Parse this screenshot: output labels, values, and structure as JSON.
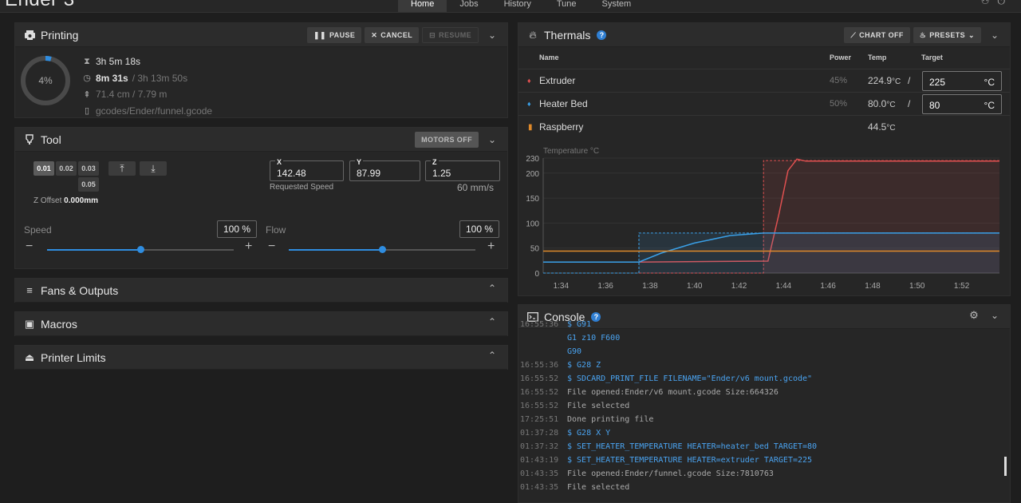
{
  "app": {
    "title": "Ender 3"
  },
  "nav": {
    "tabs": [
      "Home",
      "Jobs",
      "History",
      "Tune",
      "System"
    ]
  },
  "printing": {
    "title": "Printing",
    "buttons": {
      "pause": "PAUSE",
      "cancel": "CANCEL",
      "resume": "RESUME"
    },
    "progress_label": "4%",
    "progress_value": 4,
    "total_time": "3h 5m 18s",
    "elapsed": "8m 31s",
    "remaining": "/ 3h 13m 50s",
    "filament": "71.4 cm / 7.79 m",
    "file": "gcodes/Ender/funnel.gcode"
  },
  "tool": {
    "title": "Tool",
    "motors_off": "MOTORS OFF",
    "z_steps": [
      "0.01",
      "0.02",
      "0.03",
      "0.05"
    ],
    "z_offset_label": "Z Offset",
    "z_offset_value": "0.000mm",
    "x_label": "X",
    "x_value": "142.48",
    "y_label": "Y",
    "y_value": "87.99",
    "z_label": "Z",
    "z_value": "1.25",
    "requested_speed_label": "Requested Speed",
    "requested_speed": "60 mm/s",
    "speed_label": "Speed",
    "speed_value": "100 %",
    "flow_label": "Flow",
    "flow_value": "100 %"
  },
  "fans": {
    "title": "Fans & Outputs"
  },
  "macros": {
    "title": "Macros"
  },
  "limits": {
    "title": "Printer Limits"
  },
  "thermals": {
    "title": "Thermals",
    "chart_off": "CHART OFF",
    "presets": "PRESETS",
    "headers": {
      "name": "Name",
      "power": "Power",
      "temp": "Temp",
      "target": "Target"
    },
    "rows": [
      {
        "name": "Extruder",
        "power": "45%",
        "temp": "224.9",
        "unit": "°C",
        "slash": "/",
        "target": "225",
        "target_unit": "°C",
        "color": "#e05050"
      },
      {
        "name": "Heater Bed",
        "power": "50%",
        "temp": "80.0",
        "unit": "°C",
        "slash": "/",
        "target": "80",
        "target_unit": "°C",
        "color": "#3aa0e8"
      },
      {
        "name": "Raspberry",
        "power": "",
        "temp": "44.5",
        "unit": "°C",
        "slash": "",
        "target": "",
        "target_unit": "",
        "color": "#e08a2a"
      }
    ]
  },
  "chart_data": {
    "type": "line",
    "title": "Temperature °C",
    "xlabel": "",
    "ylabel": "Temperature °C",
    "x_ticks": [
      "1:34",
      "1:36",
      "1:38",
      "1:40",
      "1:42",
      "1:44",
      "1:46",
      "1:48",
      "1:50",
      "1:52"
    ],
    "y_ticks": [
      0,
      50,
      100,
      150,
      200,
      230
    ],
    "ylim": [
      0,
      230
    ],
    "series": [
      {
        "name": "Extruder",
        "color": "#e05050",
        "x": [
          "1:33.2",
          "1:37.5",
          "1:43.3",
          "1:43.8",
          "1:44.2",
          "1:44.6",
          "1:45",
          "1:53.7"
        ],
        "y": [
          22,
          22,
          24,
          120,
          205,
          228,
          224,
          224
        ]
      },
      {
        "name": "Extruder Target",
        "color": "#e05050",
        "dashed": true,
        "x": [
          "1:33.2",
          "1:43.1",
          "1:43.1",
          "1:53.7"
        ],
        "y": [
          0,
          0,
          225,
          225
        ]
      },
      {
        "name": "Heater Bed",
        "color": "#3aa0e8",
        "x": [
          "1:33.2",
          "1:37.5",
          "1:38.5",
          "1:40",
          "1:41.6",
          "1:43.1",
          "1:53.7"
        ],
        "y": [
          22,
          22,
          40,
          60,
          75,
          80,
          80
        ]
      },
      {
        "name": "Heater Bed Target",
        "color": "#3aa0e8",
        "dashed": true,
        "x": [
          "1:33.2",
          "1:37.5",
          "1:37.5",
          "1:53.7"
        ],
        "y": [
          0,
          0,
          80,
          80
        ]
      },
      {
        "name": "Raspberry",
        "color": "#e08a2a",
        "x": [
          "1:33.2",
          "1:53.7"
        ],
        "y": [
          44,
          44
        ]
      }
    ]
  },
  "console": {
    "title": "Console",
    "lines": [
      {
        "time": "16:55:36",
        "text": "$ G91",
        "kind": "cmd"
      },
      {
        "time": "",
        "text": "G1 z10 F600",
        "kind": "cmd"
      },
      {
        "time": "",
        "text": "G90",
        "kind": "cmd"
      },
      {
        "time": "16:55:36",
        "text": "$ G28 Z",
        "kind": "cmd"
      },
      {
        "time": "16:55:52",
        "text": "$ SDCARD_PRINT_FILE FILENAME=\"Ender/v6 mount.gcode\"",
        "kind": "cmd"
      },
      {
        "time": "16:55:52",
        "text": "File opened:Ender/v6 mount.gcode Size:664326",
        "kind": "msg"
      },
      {
        "time": "16:55:52",
        "text": "File selected",
        "kind": "msg"
      },
      {
        "time": "17:25:51",
        "text": "Done printing file",
        "kind": "msg"
      },
      {
        "time": "01:37:28",
        "text": "$ G28 X Y",
        "kind": "cmd"
      },
      {
        "time": "01:37:32",
        "text": "$ SET_HEATER_TEMPERATURE HEATER=heater_bed TARGET=80",
        "kind": "cmd"
      },
      {
        "time": "01:43:19",
        "text": "$ SET_HEATER_TEMPERATURE HEATER=extruder TARGET=225",
        "kind": "cmd"
      },
      {
        "time": "01:43:35",
        "text": "File opened:Ender/funnel.gcode Size:7810763",
        "kind": "msg"
      },
      {
        "time": "01:43:35",
        "text": "File selected",
        "kind": "msg"
      }
    ]
  }
}
